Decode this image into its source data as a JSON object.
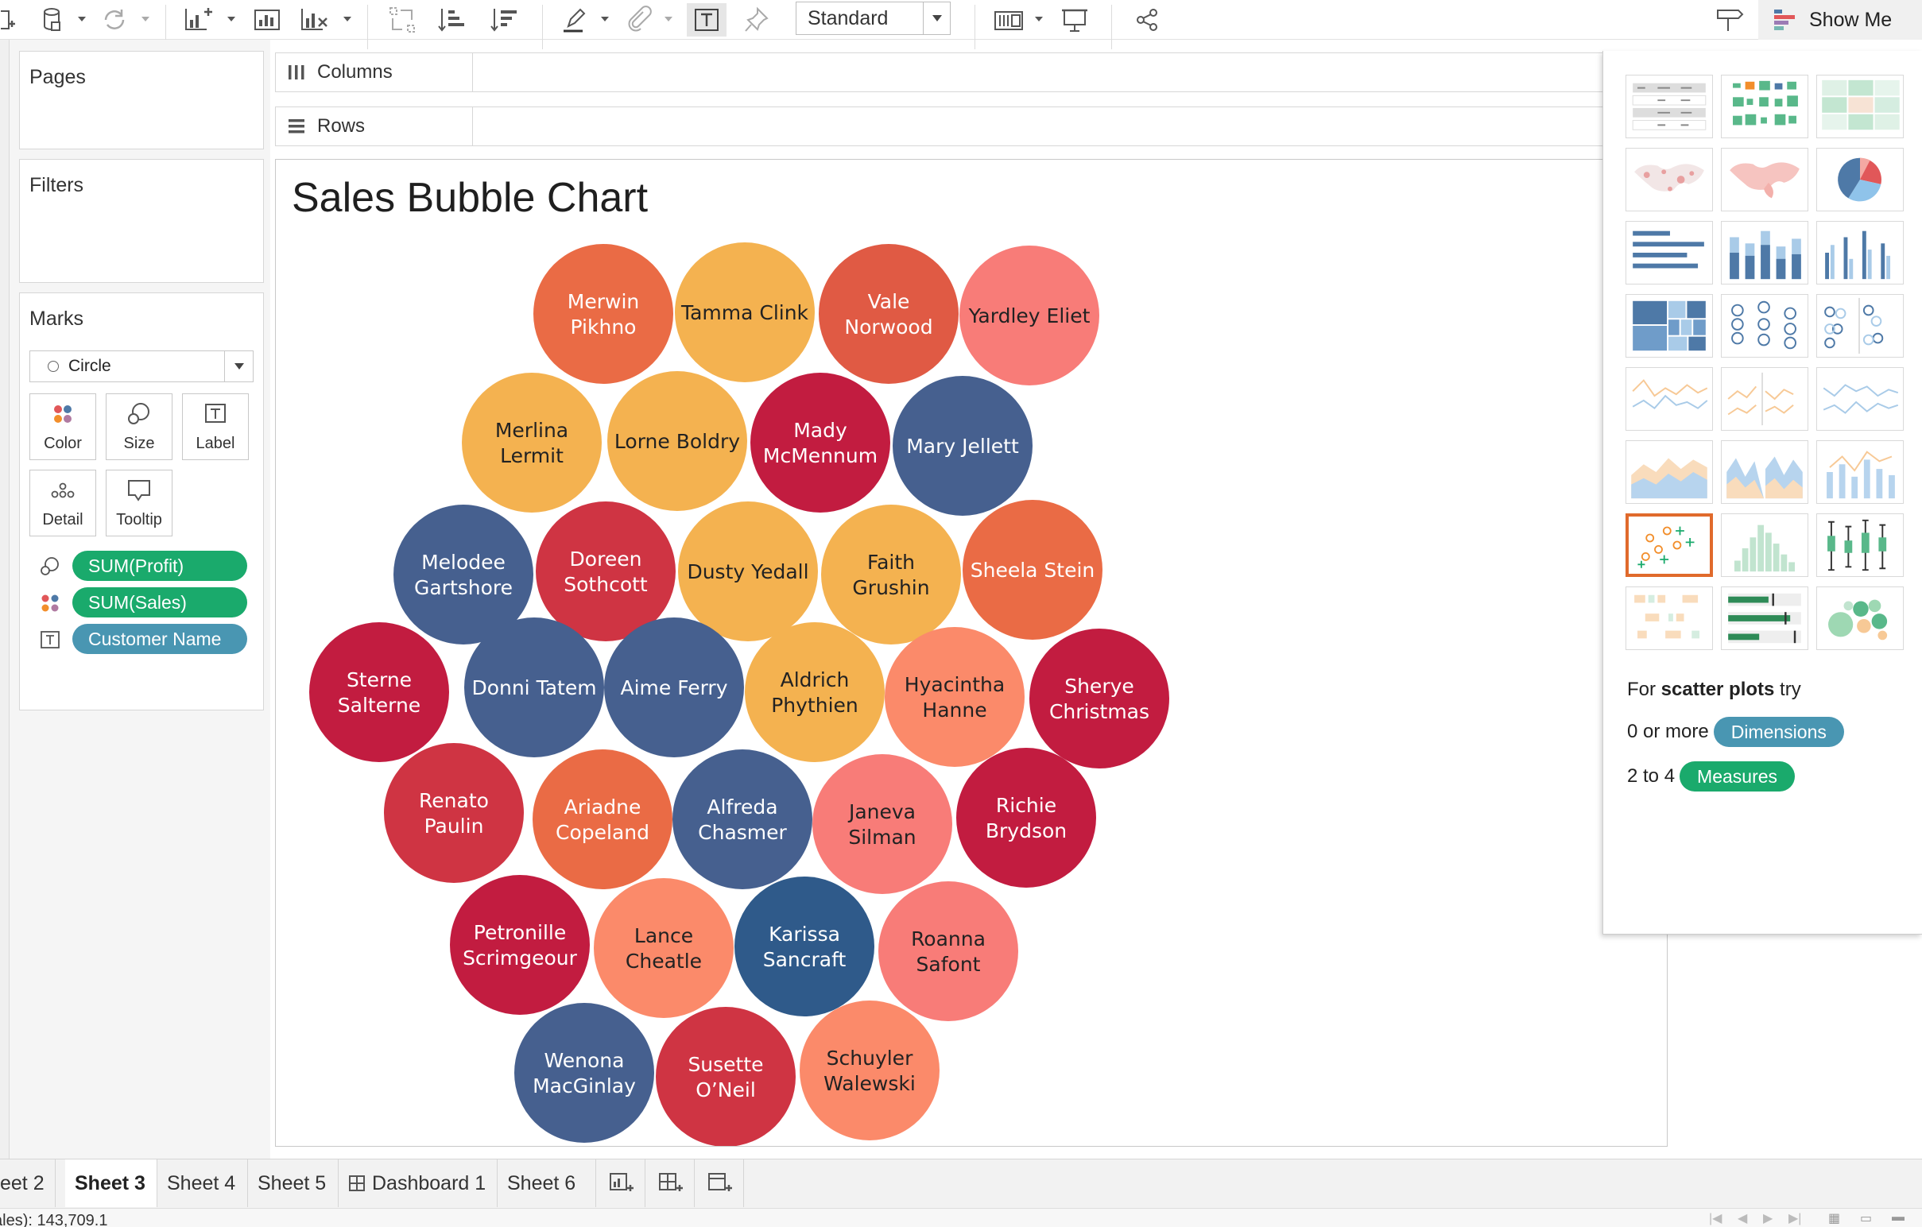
{
  "toolbar": {
    "fit_select": "Standard",
    "show_me_label": "Show Me"
  },
  "cards": {
    "pages": "Pages",
    "filters": "Filters",
    "marks": "Marks"
  },
  "marks": {
    "mark_type": "Circle",
    "buttons": [
      {
        "label": "Color",
        "icon": "color-icon"
      },
      {
        "label": "Size",
        "icon": "size-icon"
      },
      {
        "label": "Label",
        "icon": "label-icon"
      },
      {
        "label": "Detail",
        "icon": "detail-icon"
      },
      {
        "label": "Tooltip",
        "icon": "tooltip-icon"
      }
    ],
    "pills": [
      {
        "label": "SUM(Profit)",
        "icon": "size-icon",
        "color": "#1aaa6c"
      },
      {
        "label": "SUM(Sales)",
        "icon": "color-icon",
        "color": "#1aaa6c"
      },
      {
        "label": "Customer Name",
        "icon": "label-icon",
        "color": "#4996b2"
      }
    ]
  },
  "shelves": {
    "columns": "Columns",
    "rows": "Rows"
  },
  "view": {
    "title": "Sales Bubble Chart"
  },
  "bubbles": [
    {
      "name": "Merwin Pikhno",
      "lines": [
        "Merwin",
        "Pikhno"
      ],
      "color": "#ea6b45",
      "text_color": "#ffffff"
    },
    {
      "name": "Tamma Clink",
      "lines": [
        "Tamma Clink"
      ],
      "color": "#f4b250",
      "text_color": "#222222"
    },
    {
      "name": "Vale Norwood",
      "lines": [
        "Vale",
        "Norwood"
      ],
      "color": "#e05a44",
      "text_color": "#ffffff"
    },
    {
      "name": "Yardley Eliet",
      "lines": [
        "Yardley Eliet"
      ],
      "color": "#f87c78",
      "text_color": "#222222"
    },
    {
      "name": "Merlina Lermit",
      "lines": [
        "Merlina",
        "Lermit"
      ],
      "color": "#f4b250",
      "text_color": "#222222"
    },
    {
      "name": "Lorne Boldry",
      "lines": [
        "Lorne Boldry"
      ],
      "color": "#f4b250",
      "text_color": "#222222"
    },
    {
      "name": "Mady McMennum",
      "lines": [
        "Mady",
        "McMennum"
      ],
      "color": "#c21c40",
      "text_color": "#ffffff"
    },
    {
      "name": "Mary Jellett",
      "lines": [
        "Mary Jellett"
      ],
      "color": "#46608f",
      "text_color": "#ffffff"
    },
    {
      "name": "Melodee Gartshore",
      "lines": [
        "Melodee",
        "Gartshore"
      ],
      "color": "#46608f",
      "text_color": "#ffffff"
    },
    {
      "name": "Doreen Sothcott",
      "lines": [
        "Doreen",
        "Sothcott"
      ],
      "color": "#cf3443",
      "text_color": "#ffffff"
    },
    {
      "name": "Dusty Yedall",
      "lines": [
        "Dusty Yedall"
      ],
      "color": "#f4b250",
      "text_color": "#222222"
    },
    {
      "name": "Faith Grushin",
      "lines": [
        "Faith",
        "Grushin"
      ],
      "color": "#f4b250",
      "text_color": "#222222"
    },
    {
      "name": "Sheela Stein",
      "lines": [
        "Sheela Stein"
      ],
      "color": "#ea6b45",
      "text_color": "#ffffff"
    },
    {
      "name": "Sterne Salterne",
      "lines": [
        "Sterne",
        "Salterne"
      ],
      "color": "#c21c40",
      "text_color": "#ffffff"
    },
    {
      "name": "Donni Tatem",
      "lines": [
        "Donni Tatem"
      ],
      "color": "#46608f",
      "text_color": "#ffffff"
    },
    {
      "name": "Aime Ferry",
      "lines": [
        "Aime Ferry"
      ],
      "color": "#46608f",
      "text_color": "#ffffff"
    },
    {
      "name": "Aldrich Phythien",
      "lines": [
        "Aldrich",
        "Phythien"
      ],
      "color": "#f4b250",
      "text_color": "#222222"
    },
    {
      "name": "Hyacintha Hanne",
      "lines": [
        "Hyacintha",
        "Hanne"
      ],
      "color": "#fb8a6a",
      "text_color": "#222222"
    },
    {
      "name": "Sherye Christmas",
      "lines": [
        "Sherye",
        "Christmas"
      ],
      "color": "#c21c40",
      "text_color": "#ffffff"
    },
    {
      "name": "Renato Paulin",
      "lines": [
        "Renato",
        "Paulin"
      ],
      "color": "#cf3443",
      "text_color": "#ffffff"
    },
    {
      "name": "Ariadne Copeland",
      "lines": [
        "Ariadne",
        "Copeland"
      ],
      "color": "#ea6b45",
      "text_color": "#ffffff"
    },
    {
      "name": "Alfreda Chasmer",
      "lines": [
        "Alfreda",
        "Chasmer"
      ],
      "color": "#46608f",
      "text_color": "#ffffff"
    },
    {
      "name": "Janeva Silman",
      "lines": [
        "Janeva",
        "Silman"
      ],
      "color": "#f87c78",
      "text_color": "#222222"
    },
    {
      "name": "Richie Brydson",
      "lines": [
        "Richie",
        "Brydson"
      ],
      "color": "#c21c40",
      "text_color": "#ffffff"
    },
    {
      "name": "Petronille Scrimgeour",
      "lines": [
        "Petronille",
        "Scrimgeour"
      ],
      "color": "#c21c40",
      "text_color": "#ffffff"
    },
    {
      "name": "Lance Cheatle",
      "lines": [
        "Lance",
        "Cheatle"
      ],
      "color": "#fb8a6a",
      "text_color": "#222222"
    },
    {
      "name": "Karissa Sancraft",
      "lines": [
        "Karissa",
        "Sancraft"
      ],
      "color": "#2f5a8a",
      "text_color": "#ffffff"
    },
    {
      "name": "Roanna Safont",
      "lines": [
        "Roanna",
        "Safont"
      ],
      "color": "#f87c78",
      "text_color": "#222222"
    },
    {
      "name": "Wenona MacGinlay",
      "lines": [
        "Wenona",
        "MacGinlay"
      ],
      "color": "#46608f",
      "text_color": "#ffffff"
    },
    {
      "name": "Susette O'Neil",
      "lines": [
        "Susette",
        "O’Neil"
      ],
      "color": "#cf3443",
      "text_color": "#ffffff"
    },
    {
      "name": "Schuyler Walewski",
      "lines": [
        "Schuyler",
        "Walewski"
      ],
      "color": "#fb8a6a",
      "text_color": "#222222"
    }
  ],
  "show_me": {
    "hint_prefix": "For ",
    "hint_bold": "scatter plots",
    "hint_suffix": " try",
    "dimensions_prefix": "0 or more",
    "dimensions_pill": "Dimensions",
    "dimensions_color": "#4996b2",
    "measures_prefix": "2 to 4",
    "measures_pill": "Measures",
    "measures_color": "#1aaa6c",
    "selected_chart": "scatter-plot"
  },
  "tabs": [
    {
      "label": "eet 2",
      "active": false
    },
    {
      "label": "Sheet 3",
      "active": true
    },
    {
      "label": "Sheet 4",
      "active": false
    },
    {
      "label": "Sheet 5",
      "active": false
    },
    {
      "label": "Dashboard 1",
      "active": false,
      "icon": "dashboard-icon"
    },
    {
      "label": "Sheet 6",
      "active": false
    }
  ],
  "status": {
    "text": "ales): 143,709.1"
  }
}
